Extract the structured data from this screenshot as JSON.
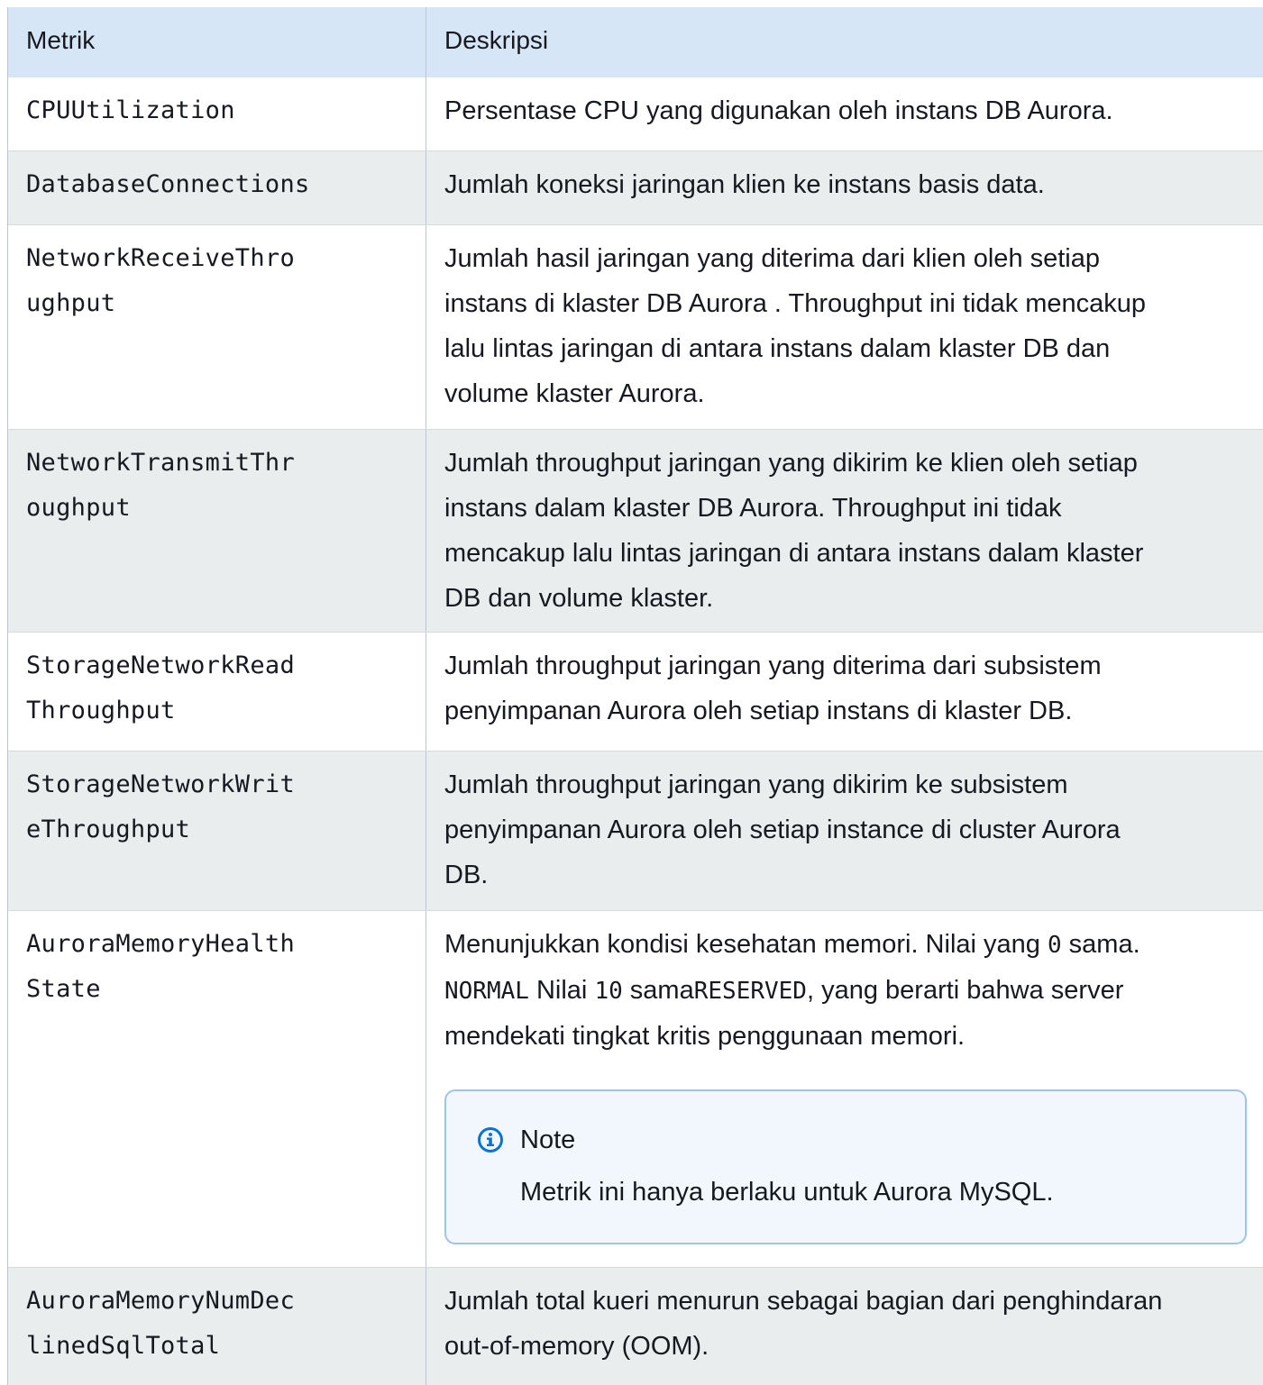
{
  "table": {
    "headers": {
      "metric": "Metrik",
      "description": "Deskripsi"
    },
    "rows": [
      {
        "metric_lines": [
          "CPUUtilization"
        ],
        "desc_lines": [
          "Persentase CPU yang digunakan oleh instans DB Aurora."
        ]
      },
      {
        "metric_lines": [
          "DatabaseConnections"
        ],
        "desc_lines": [
          "Jumlah koneksi jaringan klien ke instans basis data."
        ]
      },
      {
        "metric_lines": [
          "NetworkReceiveThro",
          "ughput"
        ],
        "desc_lines": [
          "Jumlah hasil jaringan yang diterima dari klien oleh setiap",
          "instans di klaster DB Aurora . Throughput ini tidak mencakup",
          "lalu lintas jaringan di antara instans dalam klaster DB dan",
          "volume klaster Aurora."
        ]
      },
      {
        "metric_lines": [
          "NetworkTransmitThr",
          "oughput"
        ],
        "desc_lines": [
          "Jumlah throughput jaringan yang dikirim ke klien oleh setiap",
          "instans dalam klaster DB Aurora. Throughput ini tidak",
          "mencakup lalu lintas jaringan di antara instans dalam klaster",
          "DB dan volume klaster."
        ]
      },
      {
        "metric_lines": [
          "StorageNetworkRead",
          "Throughput"
        ],
        "desc_lines": [
          "Jumlah throughput jaringan yang diterima dari subsistem",
          "penyimpanan Aurora oleh setiap instans di klaster DB."
        ]
      },
      {
        "metric_lines": [
          "StorageNetworkWrit",
          "eThroughput"
        ],
        "desc_lines": [
          "Jumlah throughput jaringan yang dikirim ke subsistem",
          "penyimpanan Aurora oleh setiap instance di cluster Aurora",
          "DB."
        ]
      },
      {
        "metric_lines": [
          "AuroraMemoryHealth",
          "State"
        ],
        "desc_parts": {
          "l1_text": "Menunjukkan kondisi kesehatan memori. Nilai yang ",
          "l1_code": "0",
          "l1_tail": " sama.",
          "l2_code1": "NORMAL",
          "l2_text1": " Nilai ",
          "l2_code2": "10",
          "l2_text2": " sama",
          "l2_code3": "RESERVED",
          "l2_text3": ", yang berarti bahwa server",
          "l3_text": "mendekati tingkat kritis penggunaan memori."
        },
        "note": {
          "icon": "info-icon",
          "title": "Note",
          "body": "Metrik ini hanya berlaku untuk Aurora MySQL."
        }
      },
      {
        "metric_lines": [
          "AuroraMemoryNumDec",
          "linedSqlTotal"
        ],
        "desc_lines": [
          "Jumlah total kueri menurun sebagai bagian dari penghindaran",
          "out-of-memory (OOM)."
        ]
      }
    ]
  }
}
